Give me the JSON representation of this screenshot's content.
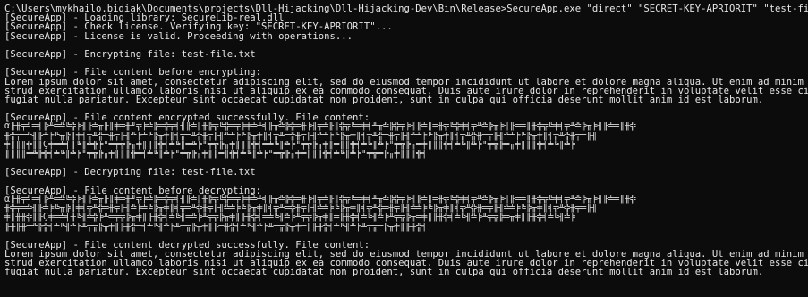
{
  "terminal": {
    "lines": [
      {
        "text": "C:\\Users\\mykhailo.bidiak\\Documents\\projects\\Dll-Hijacking\\Dll-Hijacking-Dev\\Bin\\Release>SecureApp.exe \"direct\" \"SECRET-KEY-APRIORIT\" \"test-file.txt\"",
        "kind": "prompt"
      },
      {
        "text": "[SecureApp] - Loading library: SecureLib-real.dll",
        "kind": "log"
      },
      {
        "text": "[SecureApp] - Check license. Verifying key: \"SECRET-KEY-APRIORIT\"...",
        "kind": "log"
      },
      {
        "text": "[SecureApp] - License is valid. Proceeding with operations...",
        "kind": "log"
      },
      {
        "text": "",
        "kind": "blank"
      },
      {
        "text": "[SecureApp] - Encrypting file: test-file.txt",
        "kind": "log"
      },
      {
        "text": "",
        "kind": "blank"
      },
      {
        "text": "[SecureApp] - File content before encrypting:",
        "kind": "log"
      },
      {
        "text": "Lorem ipsum dolor sit amet, consectetur adipiscing elit, sed do eiusmod tempor incididunt ut labore et dolore magna aliqua. Ut enim ad minim veniam, quis no",
        "kind": "content"
      },
      {
        "text": "strud exercitation ullamco laboris nisi ut aliquip ex ea commodo consequat. Duis aute irure dolor in reprehenderit in voluptate velit esse cillum dolore eu",
        "kind": "content"
      },
      {
        "text": "fugiat nulla pariatur. Excepteur sint occaecat cupidatat non proident, sunt in culpa qui officia deserunt mollit anim id est laborum.",
        "kind": "content"
      },
      {
        "text": "",
        "kind": "blank"
      },
      {
        "text": "[SecureApp] - File content encrypted successfully. File content:",
        "kind": "log"
      },
      {
        "text": "α╟╫╤╝═╡╠╨═╩╚╬╞╢╟╧╥╟║╪═╫╜╦╞╩╠═╬╤╡╢╟╧║╫╠╦╚╬═╤╞╪╧╨╡╟╥╩╠╬═╫╞╢╤╧╟║╬╦╚═╪╡╨╥╩╠╬╤╞╢╟╧║═╫╦╚╬╪╡╤╨╩╠╥╞╢╟═╧║╫╬╦╚╪╡╤╨╩╠╥╞╢╟╧═║╫╬",
        "kind": "enc"
      },
      {
        "text": "╫╬╤═╩╢╟╧╞╚╥╠║╪╡╦╨╬═╫╤╟╢╩╞╧╚╠╥╪║╡╦═╨╬╫╤╟╢╩╧╞╚╠╥╪║╡╦╨═╬╫╤╟╢╩╧╞╚╠╥╪║╡╦╨╬═╫╤╟╢╩╧╞╚╠╥╪║╡╦╨╬╫═╤╟╢╩╧╞╚╠╥╪║╡╦╨╬╫╤═╟╢",
        "kind": "enc"
      },
      {
        "text": "╪║╫╫╬║╟Ç╪═╧╡╫╚╢╩╬╞╨═╤╦╠╥╪║╟╫╬╡╧╚╢═╩╞╨╤╦╠╥╪║╟╫╬╡═╧╚╢╩╞╨╤╦╠╥╪║═╟╫╬╡╧╚╢╩╞╨╤╦╠╥═╪║╟╫╬╡╧╚╢╩╞╨╤╦╠═╥╪║╟╫╬╡╧╚╢╩╞",
        "kind": "enc"
      },
      {
        "text": "╟╫╟╫═╩╠╬╡╧╚╢╩╞╨╤╦╠╥╪║╟╫╬═╡╧╚╢╩╞╨╤╦╠╥╪║╟═╫╬╡╧╚╢╩╞╨╤╦╠╥╪═║╟╫╬╡╧╚╢╩╞╨╤╦═╠╥╪║╟╫╬╡",
        "kind": "enc"
      },
      {
        "text": "",
        "kind": "blank"
      },
      {
        "text": "[SecureApp] - Decrypting file: test-file.txt",
        "kind": "log"
      },
      {
        "text": "",
        "kind": "blank"
      },
      {
        "text": "[SecureApp] - File content before decrypting:",
        "kind": "log"
      },
      {
        "text": "α╟╫╤╝═╡╠╨═╩╚╬╞╢╟╧╥╟║╪═╫╜╦╞╩╠═╬╤╡╢╟╧║╫╠╦╚╬═╤╞╪╧╨╡╟╥╩╠╬═╫╞╢╤╧╟║╬╦╚═╪╡╨╥╩╠╬╤╞╢╟╧║═╫╦╚╬╪╡╤╨╩╠╥╞╢╟═╧║╫╬╦╚╪╡╤╨╩╠╥╞╢╟╧═║╫╬",
        "kind": "enc"
      },
      {
        "text": "╫╬╤═╩╢╟╧╞╚╥╠║╪╡╦╨╬═╫╤╟╢╩╞╧╚╠╥╪║╡╦═╨╬╫╤╟╢╩╧╞╚╠╥╪║╡╦╨═╬╫╤╟╢╩╧╞╚╠╥╪║╡╦╨╬═╫╤╟╢╩╧╞╚╠╥╪║╡╦╨╬╫═╤╟╢╩╧╞╚╠╥╪║╡╦╨╬╫╤═╟╢",
        "kind": "enc"
      },
      {
        "text": "╪║╫╫╬║╟Ç╪═╧╡╫╚╢╩╬╞╨═╤╦╠╥╪║╟╫╬╡╧╚╢═╩╞╨╤╦╠╥╪║╟╫╬╡═╧╚╢╩╞╨╤╦╠╥╪║═╟╫╬╡╧╚╢╩╞╨╤╦╠╥═╪║╟╫╬╡╧╚╢╩╞╨╤╦╠═╥╪║╟╫╬╡╧╚╢╩╞",
        "kind": "enc"
      },
      {
        "text": "╟╫╟╫═╩╠╬╡╧╚╢╩╞╨╤╦╠╥╪║╟╫╬═╡╧╚╢╩╞╨╤╦╠╥╪║╟═╫╬╡╧╚╢╩╞╨╤╦╠╥╪═║╟╫╬╡╧╚╢╩╞╨╤╦═╠╥╪║╟╫╬╡",
        "kind": "enc"
      },
      {
        "text": "",
        "kind": "blank"
      },
      {
        "text": "[SecureApp] - File content decrypted successfully. File content:",
        "kind": "log"
      },
      {
        "text": "Lorem ipsum dolor sit amet, consectetur adipiscing elit, sed do eiusmod tempor incididunt ut labore et dolore magna aliqua. Ut enim ad minim veniam, quis no",
        "kind": "content"
      },
      {
        "text": "strud exercitation ullamco laboris nisi ut aliquip ex ea commodo consequat. Duis aute irure dolor in reprehenderit in voluptate velit esse cillum dolore eu",
        "kind": "content"
      },
      {
        "text": "fugiat nulla pariatur. Excepteur sint occaecat cupidatat non proident, sunt in culpa qui officia deserunt mollit anim id est laborum.",
        "kind": "content"
      }
    ]
  },
  "colors": {
    "background": "#0c0c0c",
    "foreground": "#e6e6e6"
  }
}
